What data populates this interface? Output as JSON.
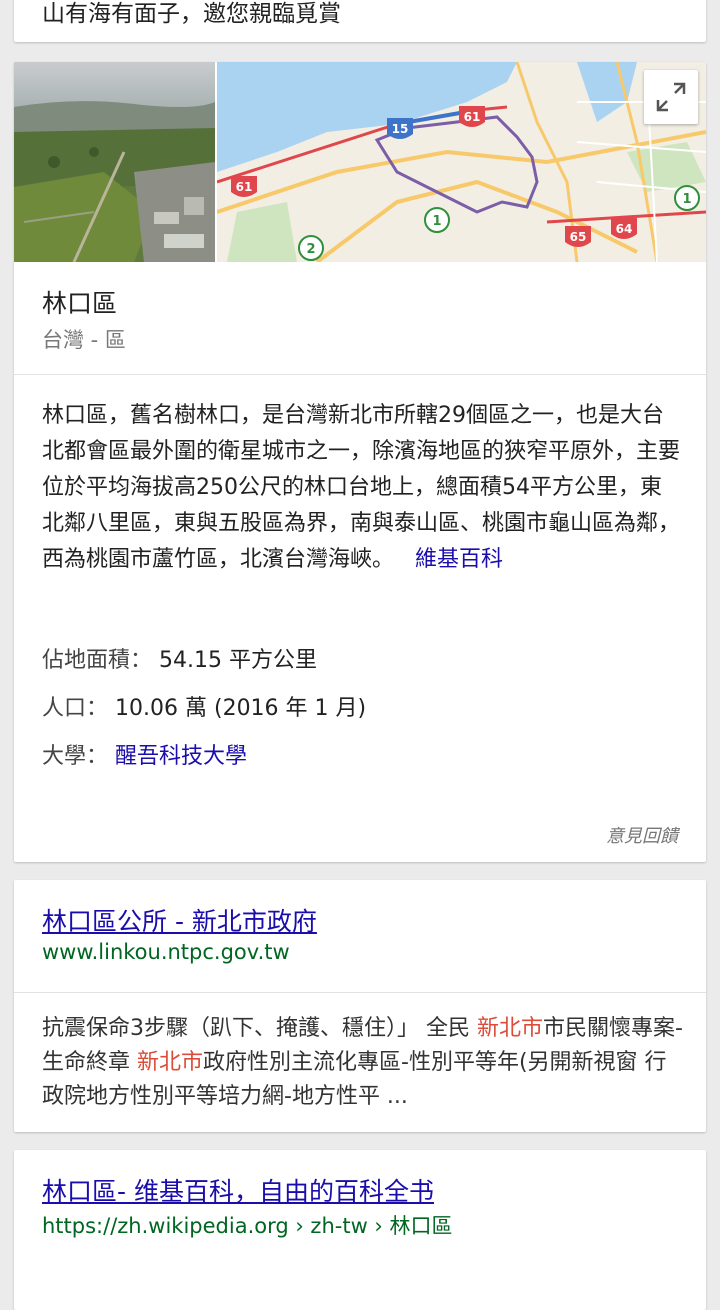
{
  "top_result": {
    "snippet_tail": "山有海有面子，邀您親臨覓賞"
  },
  "knowledge_panel": {
    "title": "林口區",
    "subtitle": "台灣 - 區",
    "description": "林口區，舊名樹林口，是台灣新北市所轄29個區之一，也是大台北都會區最外圍的衛星城市之一，除濱海地區的狹窄平原外，主要位於平均海拔高250公尺的林口台地上，總面積54平方公里，東北鄰八里區，東與五股區為界，南與泰山區、桃園市龜山區為鄰，西為桃園市蘆竹區，北濱台灣海峽。",
    "source_link": "維基百科",
    "facts": [
      {
        "label": "佔地面積：",
        "value": "54.15 平方公里"
      },
      {
        "label": "人口：",
        "value": "10.06 萬 (2016 年 1 月)"
      },
      {
        "label": "大學：",
        "value": "醒吾科技大學"
      }
    ],
    "feedback": "意見回饋",
    "map": {
      "route_shields": [
        "61",
        "15",
        "61",
        "65",
        "64"
      ],
      "circle_shields": [
        "1",
        "1",
        "2"
      ],
      "expand_icon": "expand-icon"
    }
  },
  "results": [
    {
      "title": "林口區公所 - 新北市政府",
      "url": "www.linkou.ntpc.gov.tw",
      "snippet_parts": [
        "抗震保命3步驟（趴下、掩護、穩住）」 全民 ",
        "新北市",
        "市民關懷專案-生命終章 ",
        "新北市",
        "政府性別主流化專區-性別平等年(另開新視窗 行政院地方性別平等培力網-地方性平 ..."
      ]
    },
    {
      "title": "林口區- 维基百科，自由的百科全书",
      "url": "https://zh.wikipedia.org › zh-tw › 林口區"
    }
  ],
  "colors": {
    "link": "#1a0dab",
    "url_green": "#006621",
    "highlight": "#dd4b39",
    "route_red": "#e0474c",
    "route_blue": "#3d73c8",
    "boundary_purple": "#7b5ea7"
  }
}
